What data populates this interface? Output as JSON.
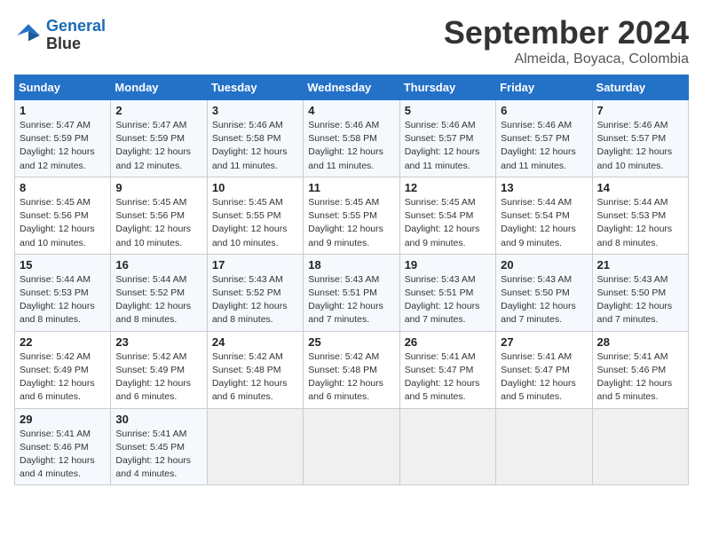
{
  "header": {
    "logo_line1": "General",
    "logo_line2": "Blue",
    "month": "September 2024",
    "location": "Almeida, Boyaca, Colombia"
  },
  "weekdays": [
    "Sunday",
    "Monday",
    "Tuesday",
    "Wednesday",
    "Thursday",
    "Friday",
    "Saturday"
  ],
  "weeks": [
    [
      {
        "day": "1",
        "info": "Sunrise: 5:47 AM\nSunset: 5:59 PM\nDaylight: 12 hours\nand 12 minutes."
      },
      {
        "day": "2",
        "info": "Sunrise: 5:47 AM\nSunset: 5:59 PM\nDaylight: 12 hours\nand 12 minutes."
      },
      {
        "day": "3",
        "info": "Sunrise: 5:46 AM\nSunset: 5:58 PM\nDaylight: 12 hours\nand 11 minutes."
      },
      {
        "day": "4",
        "info": "Sunrise: 5:46 AM\nSunset: 5:58 PM\nDaylight: 12 hours\nand 11 minutes."
      },
      {
        "day": "5",
        "info": "Sunrise: 5:46 AM\nSunset: 5:57 PM\nDaylight: 12 hours\nand 11 minutes."
      },
      {
        "day": "6",
        "info": "Sunrise: 5:46 AM\nSunset: 5:57 PM\nDaylight: 12 hours\nand 11 minutes."
      },
      {
        "day": "7",
        "info": "Sunrise: 5:46 AM\nSunset: 5:57 PM\nDaylight: 12 hours\nand 10 minutes."
      }
    ],
    [
      {
        "day": "8",
        "info": "Sunrise: 5:45 AM\nSunset: 5:56 PM\nDaylight: 12 hours\nand 10 minutes."
      },
      {
        "day": "9",
        "info": "Sunrise: 5:45 AM\nSunset: 5:56 PM\nDaylight: 12 hours\nand 10 minutes."
      },
      {
        "day": "10",
        "info": "Sunrise: 5:45 AM\nSunset: 5:55 PM\nDaylight: 12 hours\nand 10 minutes."
      },
      {
        "day": "11",
        "info": "Sunrise: 5:45 AM\nSunset: 5:55 PM\nDaylight: 12 hours\nand 9 minutes."
      },
      {
        "day": "12",
        "info": "Sunrise: 5:45 AM\nSunset: 5:54 PM\nDaylight: 12 hours\nand 9 minutes."
      },
      {
        "day": "13",
        "info": "Sunrise: 5:44 AM\nSunset: 5:54 PM\nDaylight: 12 hours\nand 9 minutes."
      },
      {
        "day": "14",
        "info": "Sunrise: 5:44 AM\nSunset: 5:53 PM\nDaylight: 12 hours\nand 8 minutes."
      }
    ],
    [
      {
        "day": "15",
        "info": "Sunrise: 5:44 AM\nSunset: 5:53 PM\nDaylight: 12 hours\nand 8 minutes."
      },
      {
        "day": "16",
        "info": "Sunrise: 5:44 AM\nSunset: 5:52 PM\nDaylight: 12 hours\nand 8 minutes."
      },
      {
        "day": "17",
        "info": "Sunrise: 5:43 AM\nSunset: 5:52 PM\nDaylight: 12 hours\nand 8 minutes."
      },
      {
        "day": "18",
        "info": "Sunrise: 5:43 AM\nSunset: 5:51 PM\nDaylight: 12 hours\nand 7 minutes."
      },
      {
        "day": "19",
        "info": "Sunrise: 5:43 AM\nSunset: 5:51 PM\nDaylight: 12 hours\nand 7 minutes."
      },
      {
        "day": "20",
        "info": "Sunrise: 5:43 AM\nSunset: 5:50 PM\nDaylight: 12 hours\nand 7 minutes."
      },
      {
        "day": "21",
        "info": "Sunrise: 5:43 AM\nSunset: 5:50 PM\nDaylight: 12 hours\nand 7 minutes."
      }
    ],
    [
      {
        "day": "22",
        "info": "Sunrise: 5:42 AM\nSunset: 5:49 PM\nDaylight: 12 hours\nand 6 minutes."
      },
      {
        "day": "23",
        "info": "Sunrise: 5:42 AM\nSunset: 5:49 PM\nDaylight: 12 hours\nand 6 minutes."
      },
      {
        "day": "24",
        "info": "Sunrise: 5:42 AM\nSunset: 5:48 PM\nDaylight: 12 hours\nand 6 minutes."
      },
      {
        "day": "25",
        "info": "Sunrise: 5:42 AM\nSunset: 5:48 PM\nDaylight: 12 hours\nand 6 minutes."
      },
      {
        "day": "26",
        "info": "Sunrise: 5:41 AM\nSunset: 5:47 PM\nDaylight: 12 hours\nand 5 minutes."
      },
      {
        "day": "27",
        "info": "Sunrise: 5:41 AM\nSunset: 5:47 PM\nDaylight: 12 hours\nand 5 minutes."
      },
      {
        "day": "28",
        "info": "Sunrise: 5:41 AM\nSunset: 5:46 PM\nDaylight: 12 hours\nand 5 minutes."
      }
    ],
    [
      {
        "day": "29",
        "info": "Sunrise: 5:41 AM\nSunset: 5:46 PM\nDaylight: 12 hours\nand 4 minutes."
      },
      {
        "day": "30",
        "info": "Sunrise: 5:41 AM\nSunset: 5:45 PM\nDaylight: 12 hours\nand 4 minutes."
      },
      {
        "day": "",
        "info": ""
      },
      {
        "day": "",
        "info": ""
      },
      {
        "day": "",
        "info": ""
      },
      {
        "day": "",
        "info": ""
      },
      {
        "day": "",
        "info": ""
      }
    ]
  ]
}
